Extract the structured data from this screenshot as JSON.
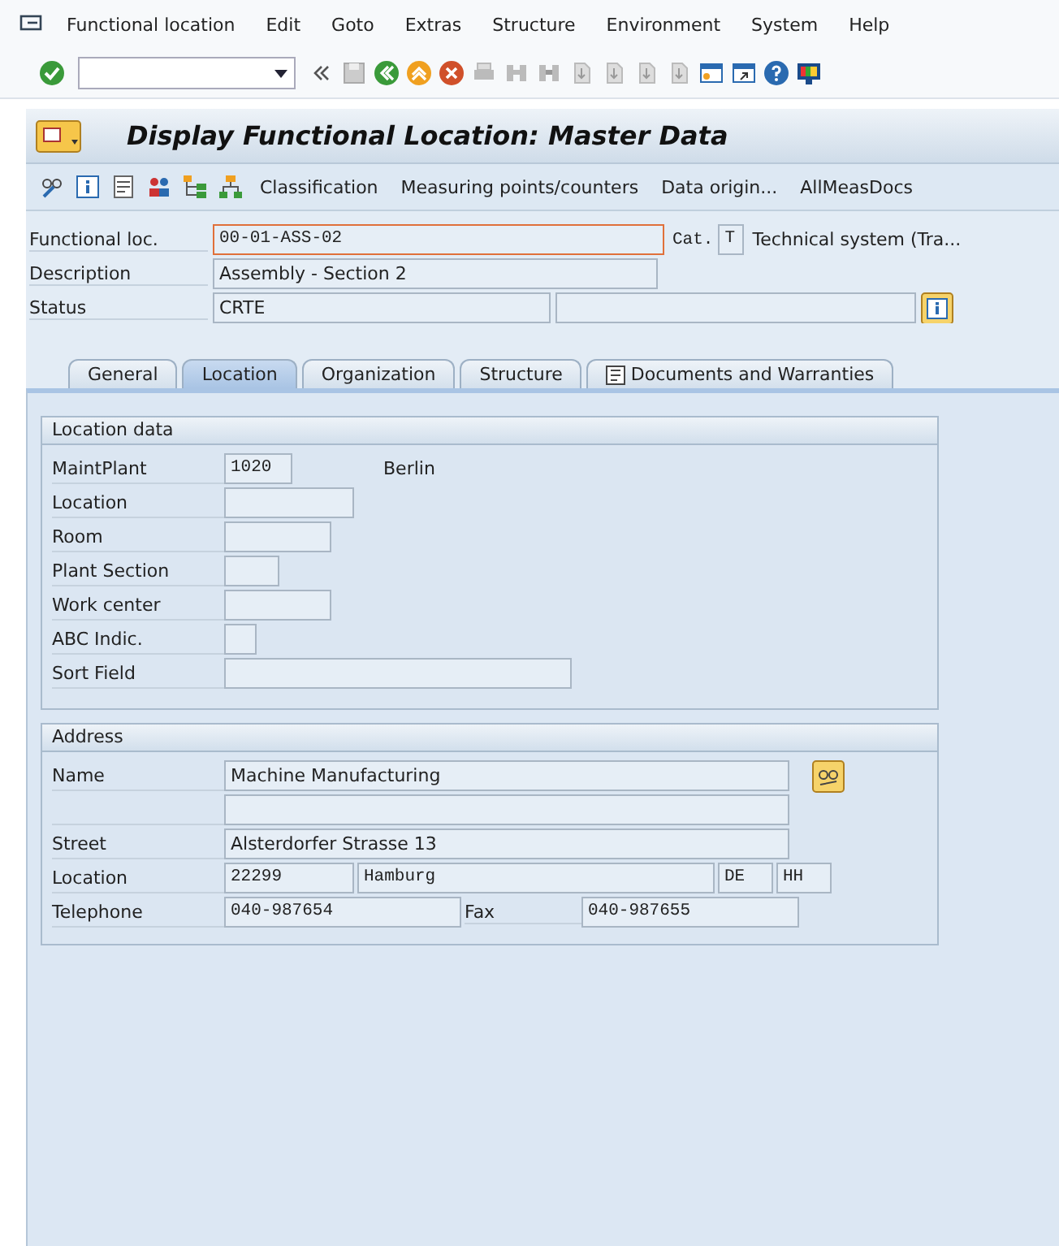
{
  "menu_bar": {
    "items": [
      "Functional location",
      "Edit",
      "Goto",
      "Extras",
      "Structure",
      "Environment",
      "System",
      "Help"
    ]
  },
  "title": "Display Functional Location: Master Data",
  "app_toolbar": {
    "buttons": [
      "Classification",
      "Measuring points/counters",
      "Data origin...",
      "AllMeasDocs"
    ]
  },
  "header": {
    "functional_loc": {
      "label": "Functional loc.",
      "value": "00-01-ASS-02"
    },
    "category": {
      "label": "Cat.",
      "value": "T",
      "text": "Technical system (Tra..."
    },
    "description": {
      "label": "Description",
      "value": "Assembly - Section 2"
    },
    "status": {
      "label": "Status",
      "value": "CRTE"
    }
  },
  "tabs": [
    {
      "label": "General",
      "selected": false
    },
    {
      "label": "Location",
      "selected": true
    },
    {
      "label": "Organization",
      "selected": false
    },
    {
      "label": "Structure",
      "selected": false
    },
    {
      "label": "Documents and Warranties",
      "selected": false
    }
  ],
  "location_data": {
    "title": "Location data",
    "rows": [
      {
        "label": "MaintPlant",
        "value": "1020",
        "text": "Berlin"
      },
      {
        "label": "Location"
      },
      {
        "label": "Room"
      },
      {
        "label": "Plant Section"
      },
      {
        "label": "Work center"
      },
      {
        "label": "ABC Indic."
      },
      {
        "label": "Sort Field"
      }
    ]
  },
  "address": {
    "title": "Address",
    "rows": [
      {
        "label": "Name",
        "fields": [
          {
            "kind": "field",
            "value": "Machine Manufacturing"
          }
        ]
      },
      {
        "fields": [
          {
            "kind": "field"
          }
        ]
      },
      {
        "label": "Street",
        "fields": [
          {
            "kind": "field",
            "value": "Alsterdorfer Strasse 13"
          }
        ]
      },
      {
        "label": "Location",
        "fields": [
          {
            "kind": "field",
            "value": "22299"
          },
          {
            "kind": "field",
            "value": "Hamburg"
          },
          {
            "kind": "field",
            "value": "DE"
          },
          {
            "kind": "field",
            "value": "HH"
          }
        ]
      },
      {
        "label": "Telephone",
        "fields": [
          {
            "kind": "field",
            "value": "040-987654"
          },
          {
            "kind": "label",
            "text": "Fax"
          },
          {
            "kind": "field",
            "value": "040-987655"
          }
        ]
      }
    ]
  }
}
